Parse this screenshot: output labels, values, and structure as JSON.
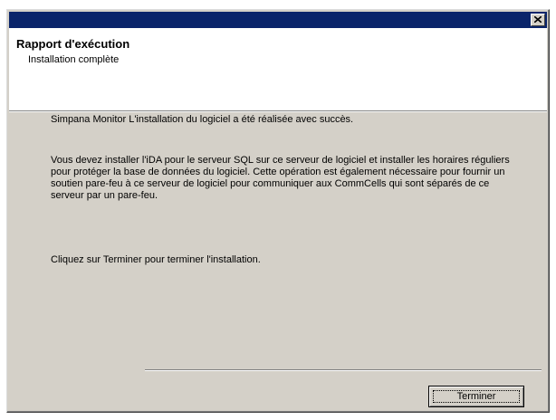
{
  "window": {
    "close_glyph": "×"
  },
  "header": {
    "title": "Rapport d'exécution",
    "subtitle": "Installation complète"
  },
  "body": {
    "paragraphs": [
      "Simpana Monitor L'installation du logiciel a été réalisée avec succès.",
      "Vous devez installer l'iDA pour le serveur SQL sur ce serveur de logiciel et installer les horaires réguliers pour protéger la base de données du logiciel. Cette opération est également nécessaire pour fournir un soutien pare-feu à ce serveur de logiciel pour communiquer aux CommCells qui sont séparés de ce serveur par un pare-feu.",
      "Cliquez sur Terminer pour terminer l'installation."
    ]
  },
  "footer": {
    "finish_label": "Terminer"
  },
  "colors": {
    "titlebar": "#0a246a",
    "dialog_face": "#d4d0c8",
    "header_bg": "#ffffff"
  }
}
